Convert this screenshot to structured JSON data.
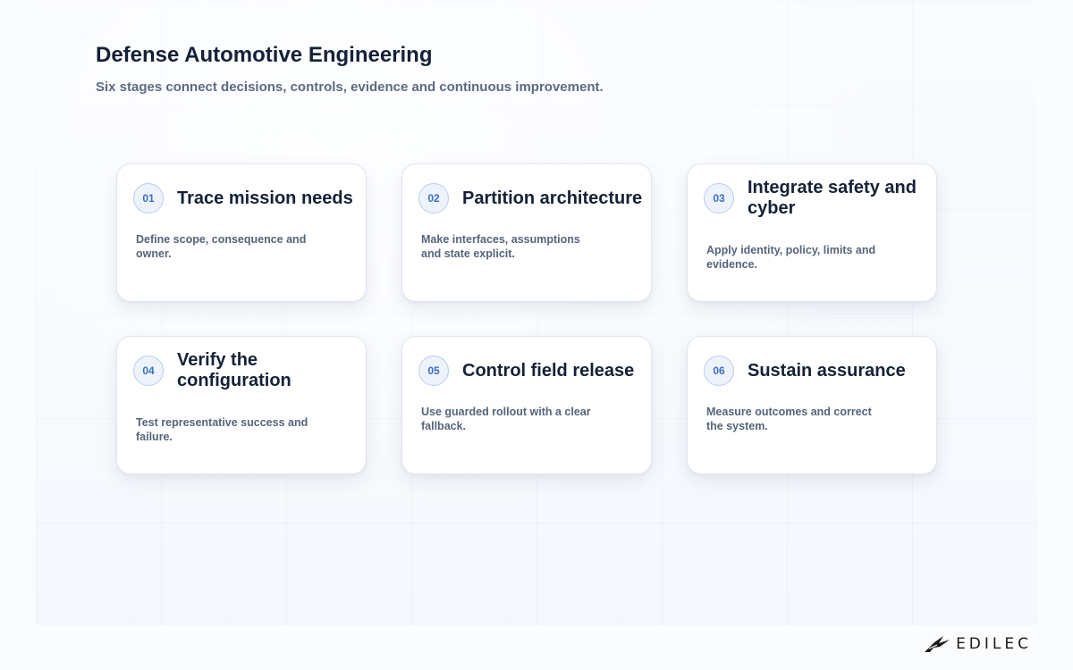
{
  "header": {
    "title": "Defense Automotive Engineering",
    "subtitle": "Six stages connect decisions, controls, evidence and continuous improvement."
  },
  "stages": [
    {
      "number": "01",
      "title": "Trace mission needs",
      "description": "Define scope, consequence and owner."
    },
    {
      "number": "02",
      "title": "Partition architecture",
      "description": "Make interfaces, assumptions and state explicit."
    },
    {
      "number": "03",
      "title": "Integrate safety and cyber",
      "description": "Apply identity, policy, limits and evidence."
    },
    {
      "number": "04",
      "title": "Verify the configuration",
      "description": "Test representative success and failure."
    },
    {
      "number": "05",
      "title": "Control field release",
      "description": "Use guarded rollout with a clear fallback."
    },
    {
      "number": "06",
      "title": "Sustain assurance",
      "description": "Measure outcomes and correct the system."
    }
  ],
  "footer": {
    "brand": "EDILEC",
    "brand_icon": "bird-logo-icon"
  },
  "colors": {
    "heading": "#152136",
    "body_text": "#56647a",
    "badge_accent": "#3b6fc2",
    "badge_border": "#b9cdec"
  }
}
